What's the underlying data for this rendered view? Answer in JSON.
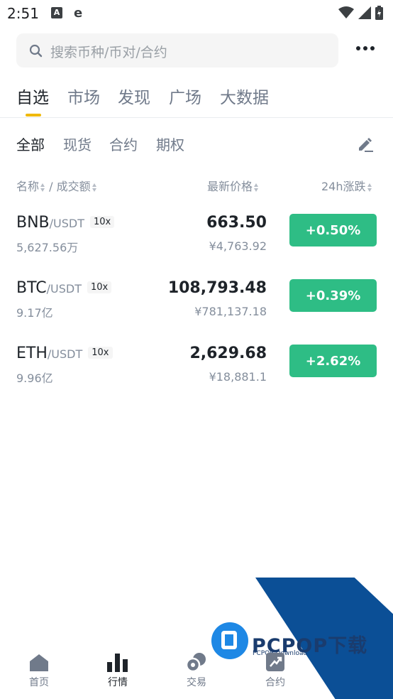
{
  "status": {
    "time": "2:51"
  },
  "search": {
    "placeholder": "搜索币种/币对/合约"
  },
  "tabs": [
    {
      "label": "自选",
      "active": true
    },
    {
      "label": "市场",
      "active": false
    },
    {
      "label": "发现",
      "active": false
    },
    {
      "label": "广场",
      "active": false
    },
    {
      "label": "大数据",
      "active": false
    }
  ],
  "subtabs": [
    {
      "label": "全部",
      "active": true
    },
    {
      "label": "现货",
      "active": false
    },
    {
      "label": "合约",
      "active": false
    },
    {
      "label": "期权",
      "active": false
    }
  ],
  "columns": {
    "name": "名称",
    "sep": "/",
    "volume": "成交额",
    "price": "最新价格",
    "change": "24h涨跌"
  },
  "rows": [
    {
      "base": "BNB",
      "quote": "/USDT",
      "leverage": "10x",
      "volume": "5,627.56万",
      "price": "663.50",
      "fiat": "¥4,763.92",
      "change": "+0.50%"
    },
    {
      "base": "BTC",
      "quote": "/USDT",
      "leverage": "10x",
      "volume": "9.17亿",
      "price": "108,793.48",
      "fiat": "¥781,137.18",
      "change": "+0.39%"
    },
    {
      "base": "ETH",
      "quote": "/USDT",
      "leverage": "10x",
      "volume": "9.96亿",
      "price": "2,629.68",
      "fiat": "¥18,881.1",
      "change": "+2.62%"
    }
  ],
  "colors": {
    "up": "#2ebd85",
    "accent": "#f0b90b"
  },
  "nav": [
    {
      "label": "首页",
      "icon": "home-icon",
      "active": false
    },
    {
      "label": "行情",
      "icon": "bar-chart-icon",
      "active": true
    },
    {
      "label": "交易",
      "icon": "trade-icon",
      "active": false
    },
    {
      "label": "合约",
      "icon": "futures-icon",
      "active": false
    }
  ],
  "watermark": {
    "text": "PCPOP下载",
    "sub": "PCPOP Download"
  }
}
